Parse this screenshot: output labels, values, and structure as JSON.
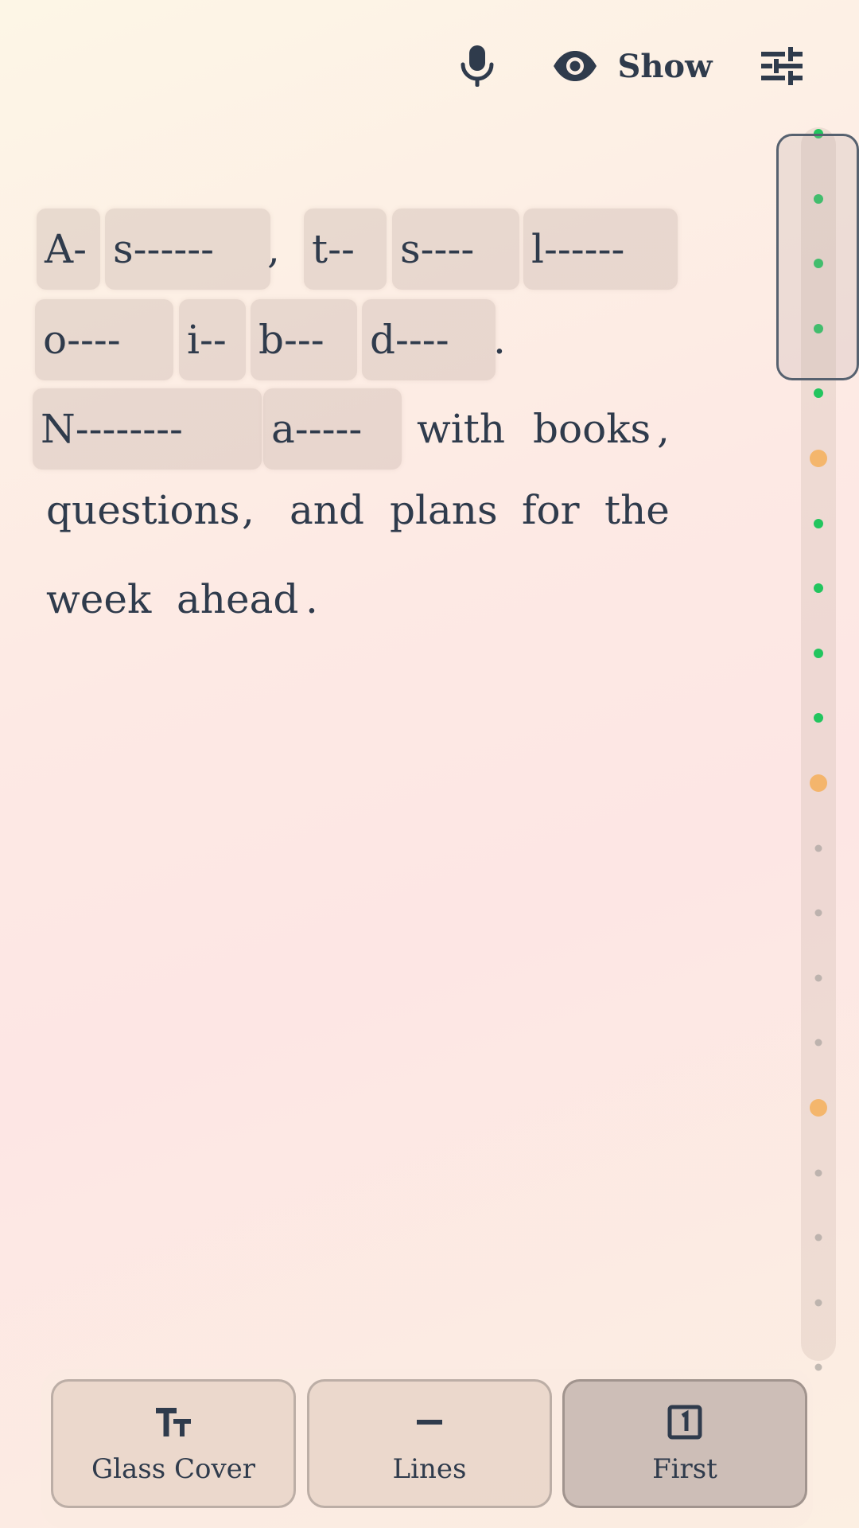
{
  "toolbar": {
    "mic_icon": "microphone-icon",
    "show_icon": "eye-icon",
    "show_label": "Show",
    "settings_icon": "sliders-icon"
  },
  "passage": {
    "tokens": [
      {
        "text": "A-",
        "hidden": true
      },
      {
        "text": "s------",
        "hidden": true
      },
      {
        "text": ",",
        "hidden": false
      },
      {
        "text": "t--",
        "hidden": true
      },
      {
        "text": "s----",
        "hidden": true
      },
      {
        "text": "l------",
        "hidden": true
      },
      {
        "text": "o----",
        "hidden": true
      },
      {
        "text": "i--",
        "hidden": true
      },
      {
        "text": "b---",
        "hidden": true
      },
      {
        "text": "d----",
        "hidden": true
      },
      {
        "text": ".",
        "hidden": false
      },
      {
        "text": "N--------",
        "hidden": true
      },
      {
        "text": "a-----",
        "hidden": true
      },
      {
        "text": "with",
        "hidden": false
      },
      {
        "text": "books",
        "hidden": false
      },
      {
        "text": ",",
        "hidden": false
      },
      {
        "text": "questions",
        "hidden": false
      },
      {
        "text": ",",
        "hidden": false
      },
      {
        "text": "and",
        "hidden": false
      },
      {
        "text": "plans",
        "hidden": false
      },
      {
        "text": "for",
        "hidden": false
      },
      {
        "text": "the",
        "hidden": false
      },
      {
        "text": "week",
        "hidden": false
      },
      {
        "text": "ahead",
        "hidden": false
      },
      {
        "text": ".",
        "hidden": false
      }
    ]
  },
  "progress": {
    "markers": [
      "done",
      "done",
      "done",
      "done",
      "done",
      "review",
      "done",
      "done",
      "done",
      "done",
      "review",
      "pending",
      "pending",
      "pending",
      "pending",
      "review",
      "pending",
      "pending",
      "pending",
      "pending"
    ],
    "colors": {
      "done": "#22c55e",
      "review": "#f5a94a",
      "pending": "#a8a29e"
    }
  },
  "bottom_bar": {
    "buttons": [
      {
        "label": "Glass Cover",
        "icon": "text-size-icon",
        "active": false
      },
      {
        "label": "Lines",
        "icon": "dash-icon",
        "active": false
      },
      {
        "label": "First",
        "icon": "number-one-box-icon",
        "active": true
      }
    ]
  }
}
